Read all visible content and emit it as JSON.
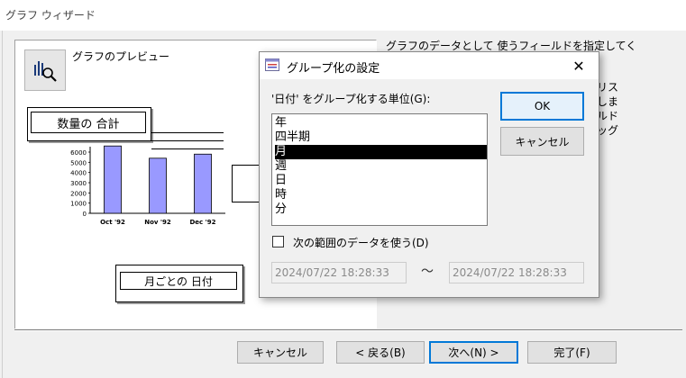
{
  "window": {
    "title": "グラフ ウィザード"
  },
  "preview": {
    "label": "グラフのプレビュー",
    "button_icon": "chart-zoom-icon"
  },
  "chart_data": {
    "type": "bar",
    "title": "数量の 合計",
    "categories": [
      "Oct '92",
      "Nov '92",
      "Dec '92"
    ],
    "values": [
      6600,
      5400,
      5800
    ],
    "yticks": [
      "6000",
      "5000",
      "4000",
      "3000",
      "2000",
      "1000",
      "0"
    ],
    "ylim": [
      0,
      6000
    ],
    "xlabel": "月ごとの 日付",
    "bar_color": "#9999ff"
  },
  "side_text": {
    "line1": "グラフのデータとして 使うフィールドを指定してく",
    "frag1": "リス",
    "frag2": "しま",
    "frag3": "ルド",
    "frag4": "ッグ"
  },
  "dialog": {
    "title": "グループ化の設定",
    "label": "'日付' をグループ化する単位(G):",
    "items": [
      "年",
      "四半期",
      "月",
      "週",
      "日",
      "時",
      "分"
    ],
    "selected_index": 2,
    "ok": "OK",
    "cancel": "キャンセル",
    "checkbox_label": "次の範囲のデータを使う(D)",
    "checkbox_checked": false,
    "from": "2024/07/22 18:28:33",
    "to": "2024/07/22 18:28:33",
    "range_sep": "～"
  },
  "wizard_buttons": {
    "cancel": "キャンセル",
    "back": "< 戻る(B)",
    "next": "次へ(N) >",
    "finish": "完了(F)"
  }
}
